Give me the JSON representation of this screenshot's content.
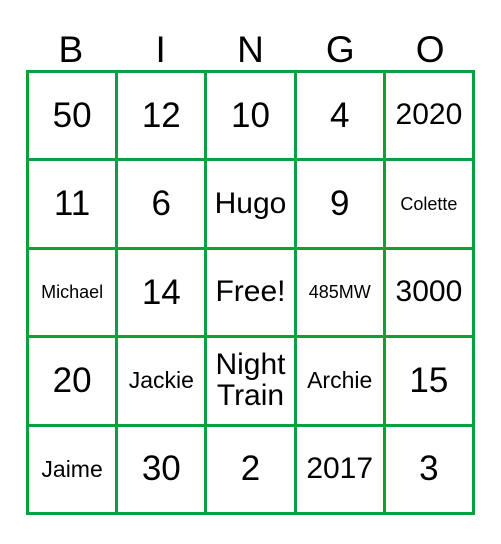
{
  "colors": {
    "grid_line": "#0aa13c",
    "text": "#000000",
    "background": "#ffffff"
  },
  "header": {
    "letters": [
      "B",
      "I",
      "N",
      "G",
      "O"
    ]
  },
  "grid": {
    "columns": 5,
    "rows": 5,
    "free_space": "Free!",
    "cells": [
      {
        "text": "50",
        "size": "xl"
      },
      {
        "text": "12",
        "size": "xl"
      },
      {
        "text": "10",
        "size": "xl"
      },
      {
        "text": "4",
        "size": "xl"
      },
      {
        "text": "2020",
        "size": "md"
      },
      {
        "text": "11",
        "size": "xl"
      },
      {
        "text": "6",
        "size": "xl"
      },
      {
        "text": "Hugo",
        "size": "md"
      },
      {
        "text": "9",
        "size": "xl"
      },
      {
        "text": "Colette",
        "size": "xs"
      },
      {
        "text": "Michael",
        "size": "xs"
      },
      {
        "text": "14",
        "size": "xl"
      },
      {
        "text": "Free!",
        "size": "md"
      },
      {
        "text": "485MW",
        "size": "xs"
      },
      {
        "text": "3000",
        "size": "md"
      },
      {
        "text": "20",
        "size": "xl"
      },
      {
        "text": "Jackie",
        "size": "sm"
      },
      {
        "text": "Night\nTrain",
        "size": "md"
      },
      {
        "text": "Archie",
        "size": "sm"
      },
      {
        "text": "15",
        "size": "xl"
      },
      {
        "text": "Jaime",
        "size": "sm"
      },
      {
        "text": "30",
        "size": "xl"
      },
      {
        "text": "2",
        "size": "xl"
      },
      {
        "text": "2017",
        "size": "md"
      },
      {
        "text": "3",
        "size": "xl"
      }
    ]
  }
}
